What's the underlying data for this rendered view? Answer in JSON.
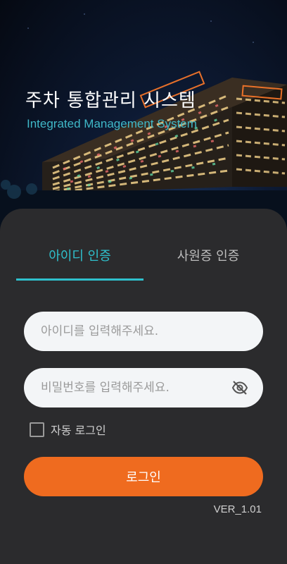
{
  "hero": {
    "title": "주차 통합관리 시스템",
    "subtitle": "Integrated Management System",
    "image": "parking-building-night-photo"
  },
  "tabs": [
    {
      "label": "아이디 인증",
      "active": true
    },
    {
      "label": "사원증 인증",
      "active": false
    }
  ],
  "form": {
    "id_placeholder": "아이디를 입력해주세요.",
    "password_placeholder": "비밀번호를 입력해주세요.",
    "password_toggle_icon": "eye-off-icon",
    "auto_login_label": "자동 로그인",
    "auto_login_checked": false,
    "login_label": "로그인"
  },
  "version": "VER_1.01",
  "colors": {
    "accent": "#2fc0cc",
    "button": "#ef6b1f",
    "background": "#2b2b2d"
  }
}
